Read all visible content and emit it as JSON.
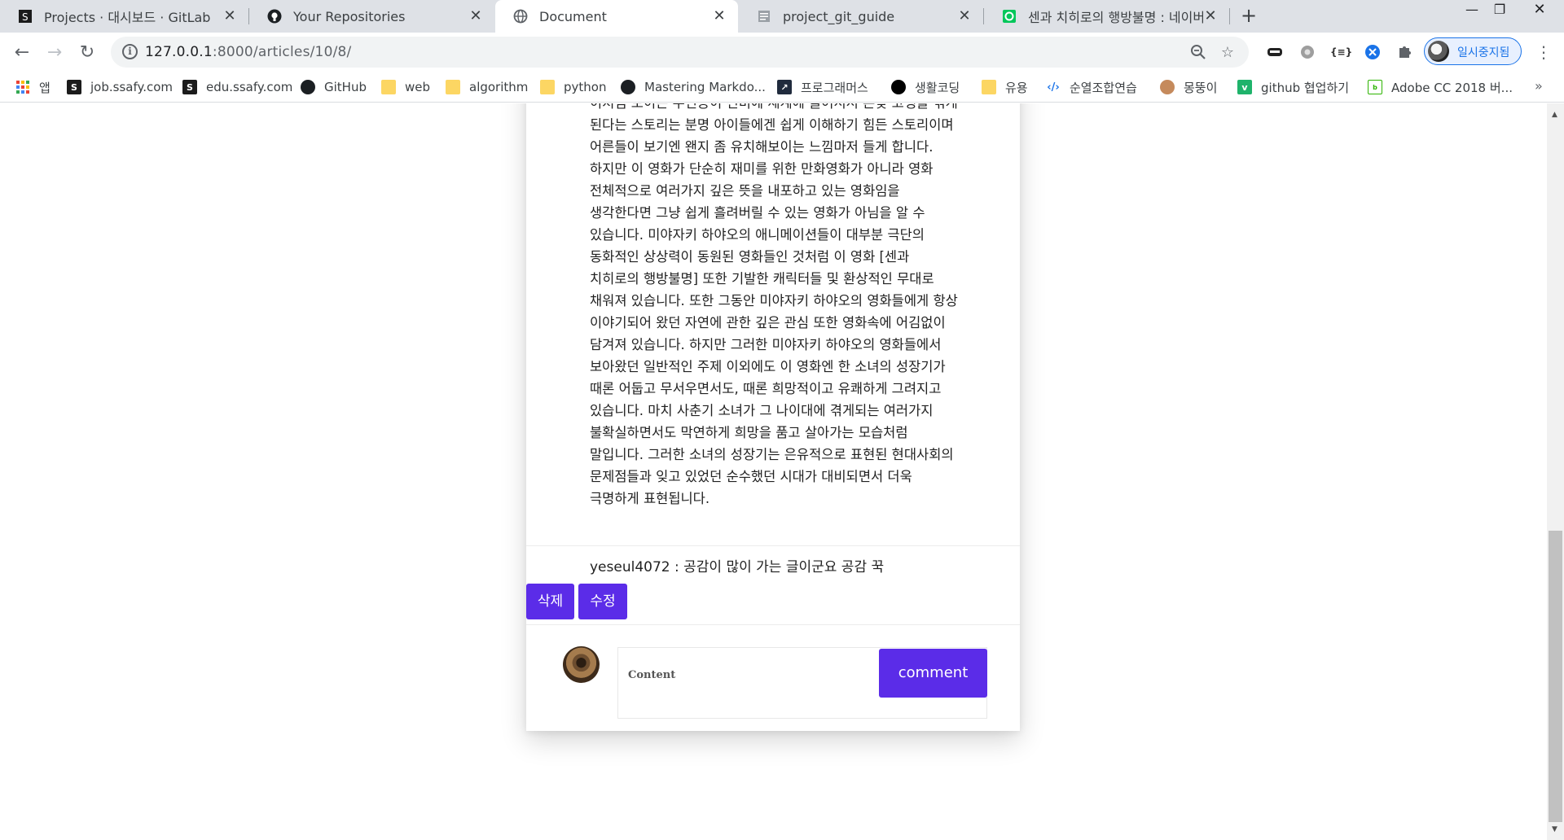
{
  "tabs": [
    {
      "title": "Projects · 대시보드 · GitLab",
      "icon": "ssafy-icon"
    },
    {
      "title": "Your Repositories",
      "icon": "github-icon"
    },
    {
      "title": "Document",
      "icon": "globe-icon"
    },
    {
      "title": "project_git_guide",
      "icon": "document-icon"
    },
    {
      "title": "센과 치히로의 행방불명 : 네이버",
      "icon": "naver-icon"
    }
  ],
  "address_bar": {
    "host": "127.0.0.1",
    "path": ":8000/articles/10/8/"
  },
  "profile": {
    "label": "일시중지됨"
  },
  "bookmarks": [
    {
      "label": "앱",
      "icon": "apps-grid-icon"
    },
    {
      "label": "job.ssafy.com",
      "icon": "ssafy-icon"
    },
    {
      "label": "edu.ssafy.com",
      "icon": "ssafy-icon"
    },
    {
      "label": "GitHub",
      "icon": "github-icon"
    },
    {
      "label": "web",
      "icon": "folder-icon"
    },
    {
      "label": "algorithm",
      "icon": "folder-icon"
    },
    {
      "label": "python",
      "icon": "folder-icon"
    },
    {
      "label": "Mastering Markdo...",
      "icon": "github-icon"
    },
    {
      "label": "프로그래머스",
      "icon": "programmers-icon"
    },
    {
      "label": "생활코딩",
      "icon": "circle-icon"
    },
    {
      "label": "유용",
      "icon": "folder-icon"
    },
    {
      "label": "순열조합연습",
      "icon": "code-icon"
    },
    {
      "label": "몽뚱이",
      "icon": "dog-icon"
    },
    {
      "label": "github 협업하기",
      "icon": "v-icon"
    },
    {
      "label": "Adobe CC 2018 버...",
      "icon": "blog-icon"
    }
  ],
  "article": {
    "body": "이처럼 보이는 주인공이 신비에 세계에 들어서서 온갖 고생을 겪게 된다는 스토리는 분명 아이들에겐 쉽게 이해하기 힘든 스토리이며 어른들이 보기엔 왠지 좀 유치해보이는 느낌마저 들게 합니다. 하지만 이 영화가 단순히 재미를 위한 만화영화가 아니라 영화 전체적으로 여러가지 깊은 뜻을 내포하고 있는 영화임을 생각한다면 그냥 쉽게 흘려버릴 수 있는 영화가 아님을 알 수 있습니다. 미야자키 하야오의 애니메이션들이 대부분 극단의 동화적인 상상력이 동원된 영화들인 것처럼 이 영화 [센과 치히로의 행방불명] 또한 기발한 캐릭터들 및 환상적인 무대로 채워져 있습니다. 또한 그동안 미야자키 하야오의 영화들에게 항상 이야기되어 왔던 자연에 관한 깊은 관심 또한 영화속에 어김없이 담겨져 있습니다. 하지만 그러한 미야자키 하야오의 영화들에서 보아왔던 일반적인 주제 이외에도 이 영화엔 한 소녀의 성장기가 때론 어둡고 무서우면서도, 때론 희망적이고 유쾌하게 그려지고 있습니다. 마치 사춘기 소녀가 그 나이대에 겪게되는 여러가지 불확실하면서도 막연하게 희망을 품고 살아가는 모습처럼 말입니다. 그러한 소녀의 성장기는 은유적으로 표현된 현대사회의 문제점들과 잊고 있었던 순수했던 시대가 대비되면서 더욱 극명하게 표현됩니다."
  },
  "comment": {
    "author": "yeseul4072",
    "separator": " : ",
    "text": "공감이 많이 가는 글이군요 공감 꾹"
  },
  "buttons": {
    "delete": "삭제",
    "edit": "수정"
  },
  "comment_form": {
    "placeholder": "Content",
    "submit": "comment"
  },
  "colors": {
    "accent": "#5b2ce8",
    "tabstrip": "#dee1e6",
    "folder": "#fcd663"
  }
}
